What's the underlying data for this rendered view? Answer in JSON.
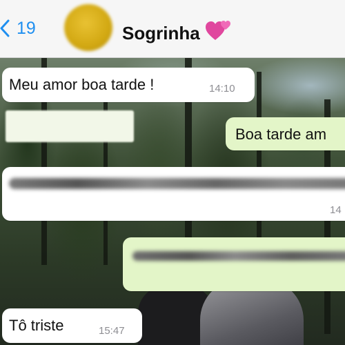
{
  "header": {
    "back_count": "19",
    "contact_name": "Sogrinha"
  },
  "messages": [
    {
      "direction": "incoming",
      "text": "Meu amor boa tarde !",
      "time": "14:10"
    },
    {
      "direction": "outgoing",
      "text": "Boa tarde am",
      "time": ""
    },
    {
      "direction": "incoming",
      "text": "",
      "time": "14",
      "content_blurred": true
    },
    {
      "direction": "outgoing",
      "text": "",
      "time": "",
      "content_blurred": true
    },
    {
      "direction": "incoming",
      "text": "Tô triste",
      "time": "15:47"
    }
  ],
  "colors": {
    "accent": "#1f8ff0",
    "incoming_bubble": "#ffffff",
    "outgoing_bubble": "#e3f5c8",
    "heart": "#e0479e"
  },
  "icons": {
    "back": "chevron-left-icon",
    "heart": "two-hearts-icon"
  }
}
